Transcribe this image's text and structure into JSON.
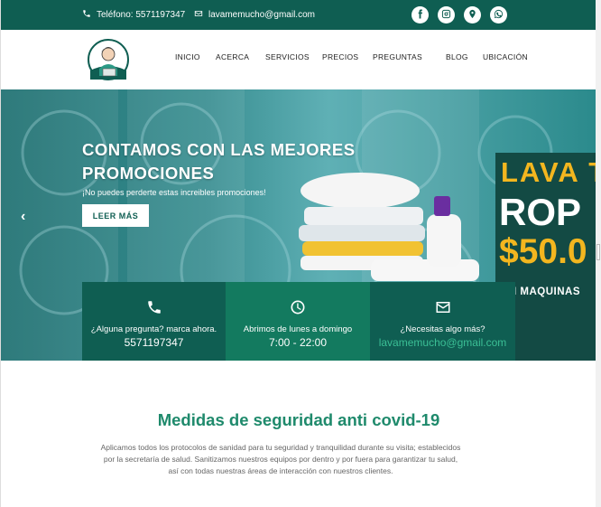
{
  "topbar": {
    "phone_label": "Teléfono: 5571197347",
    "email": "lavamemucho@gmail.com",
    "social": [
      "facebook-icon",
      "instagram-icon",
      "location-pin-icon",
      "whatsapp-icon"
    ]
  },
  "nav": {
    "items": [
      "INICIO",
      "ACERCA",
      "SERVICIOS",
      "PRECIOS",
      "PREGUNTAS",
      "BLOG",
      "UBICACIÓN"
    ]
  },
  "hero": {
    "title": "CONTAMOS CON LAS MEJORES PROMOCIONES",
    "subtitle": "¡No puedes perderte estas increibles promociones!",
    "button": "LEER MÁS",
    "promo_line1": "LAVA T",
    "promo_line2": "ROP",
    "promo_line3": "$50.0",
    "promo_line4": "I MAQUINAS"
  },
  "info_boxes": [
    {
      "icon": "phone-icon",
      "question": "¿Alguna pregunta? marca ahora.",
      "value": "5571197347",
      "color": "#0f5e52"
    },
    {
      "icon": "clock-icon",
      "question": "Abrimos de lunes a domingo",
      "value": "7:00 - 22:00",
      "color": "#137a5f"
    },
    {
      "icon": "envelope-icon",
      "question": "¿Necesitas algo más?",
      "value": "lavamemucho@gmail.com",
      "color": "#0f5e52"
    }
  ],
  "section": {
    "title": "Medidas de seguridad anti covid-19",
    "line1": "Aplicamos todos los protocolos de sanidad para tu seguridad y tranquilidad durante su visita; establecidos",
    "line2": "por la secretaría de salud. Sanitizamos nuestros equipos por dentro y por fuera para garantizar tu salud,",
    "line3": "así con todas nuestras áreas de interacción con nuestros clientes."
  },
  "colors": {
    "brand": "#0f5e52",
    "accent": "#1f8a6c",
    "promo_yellow": "#f3b61f"
  }
}
